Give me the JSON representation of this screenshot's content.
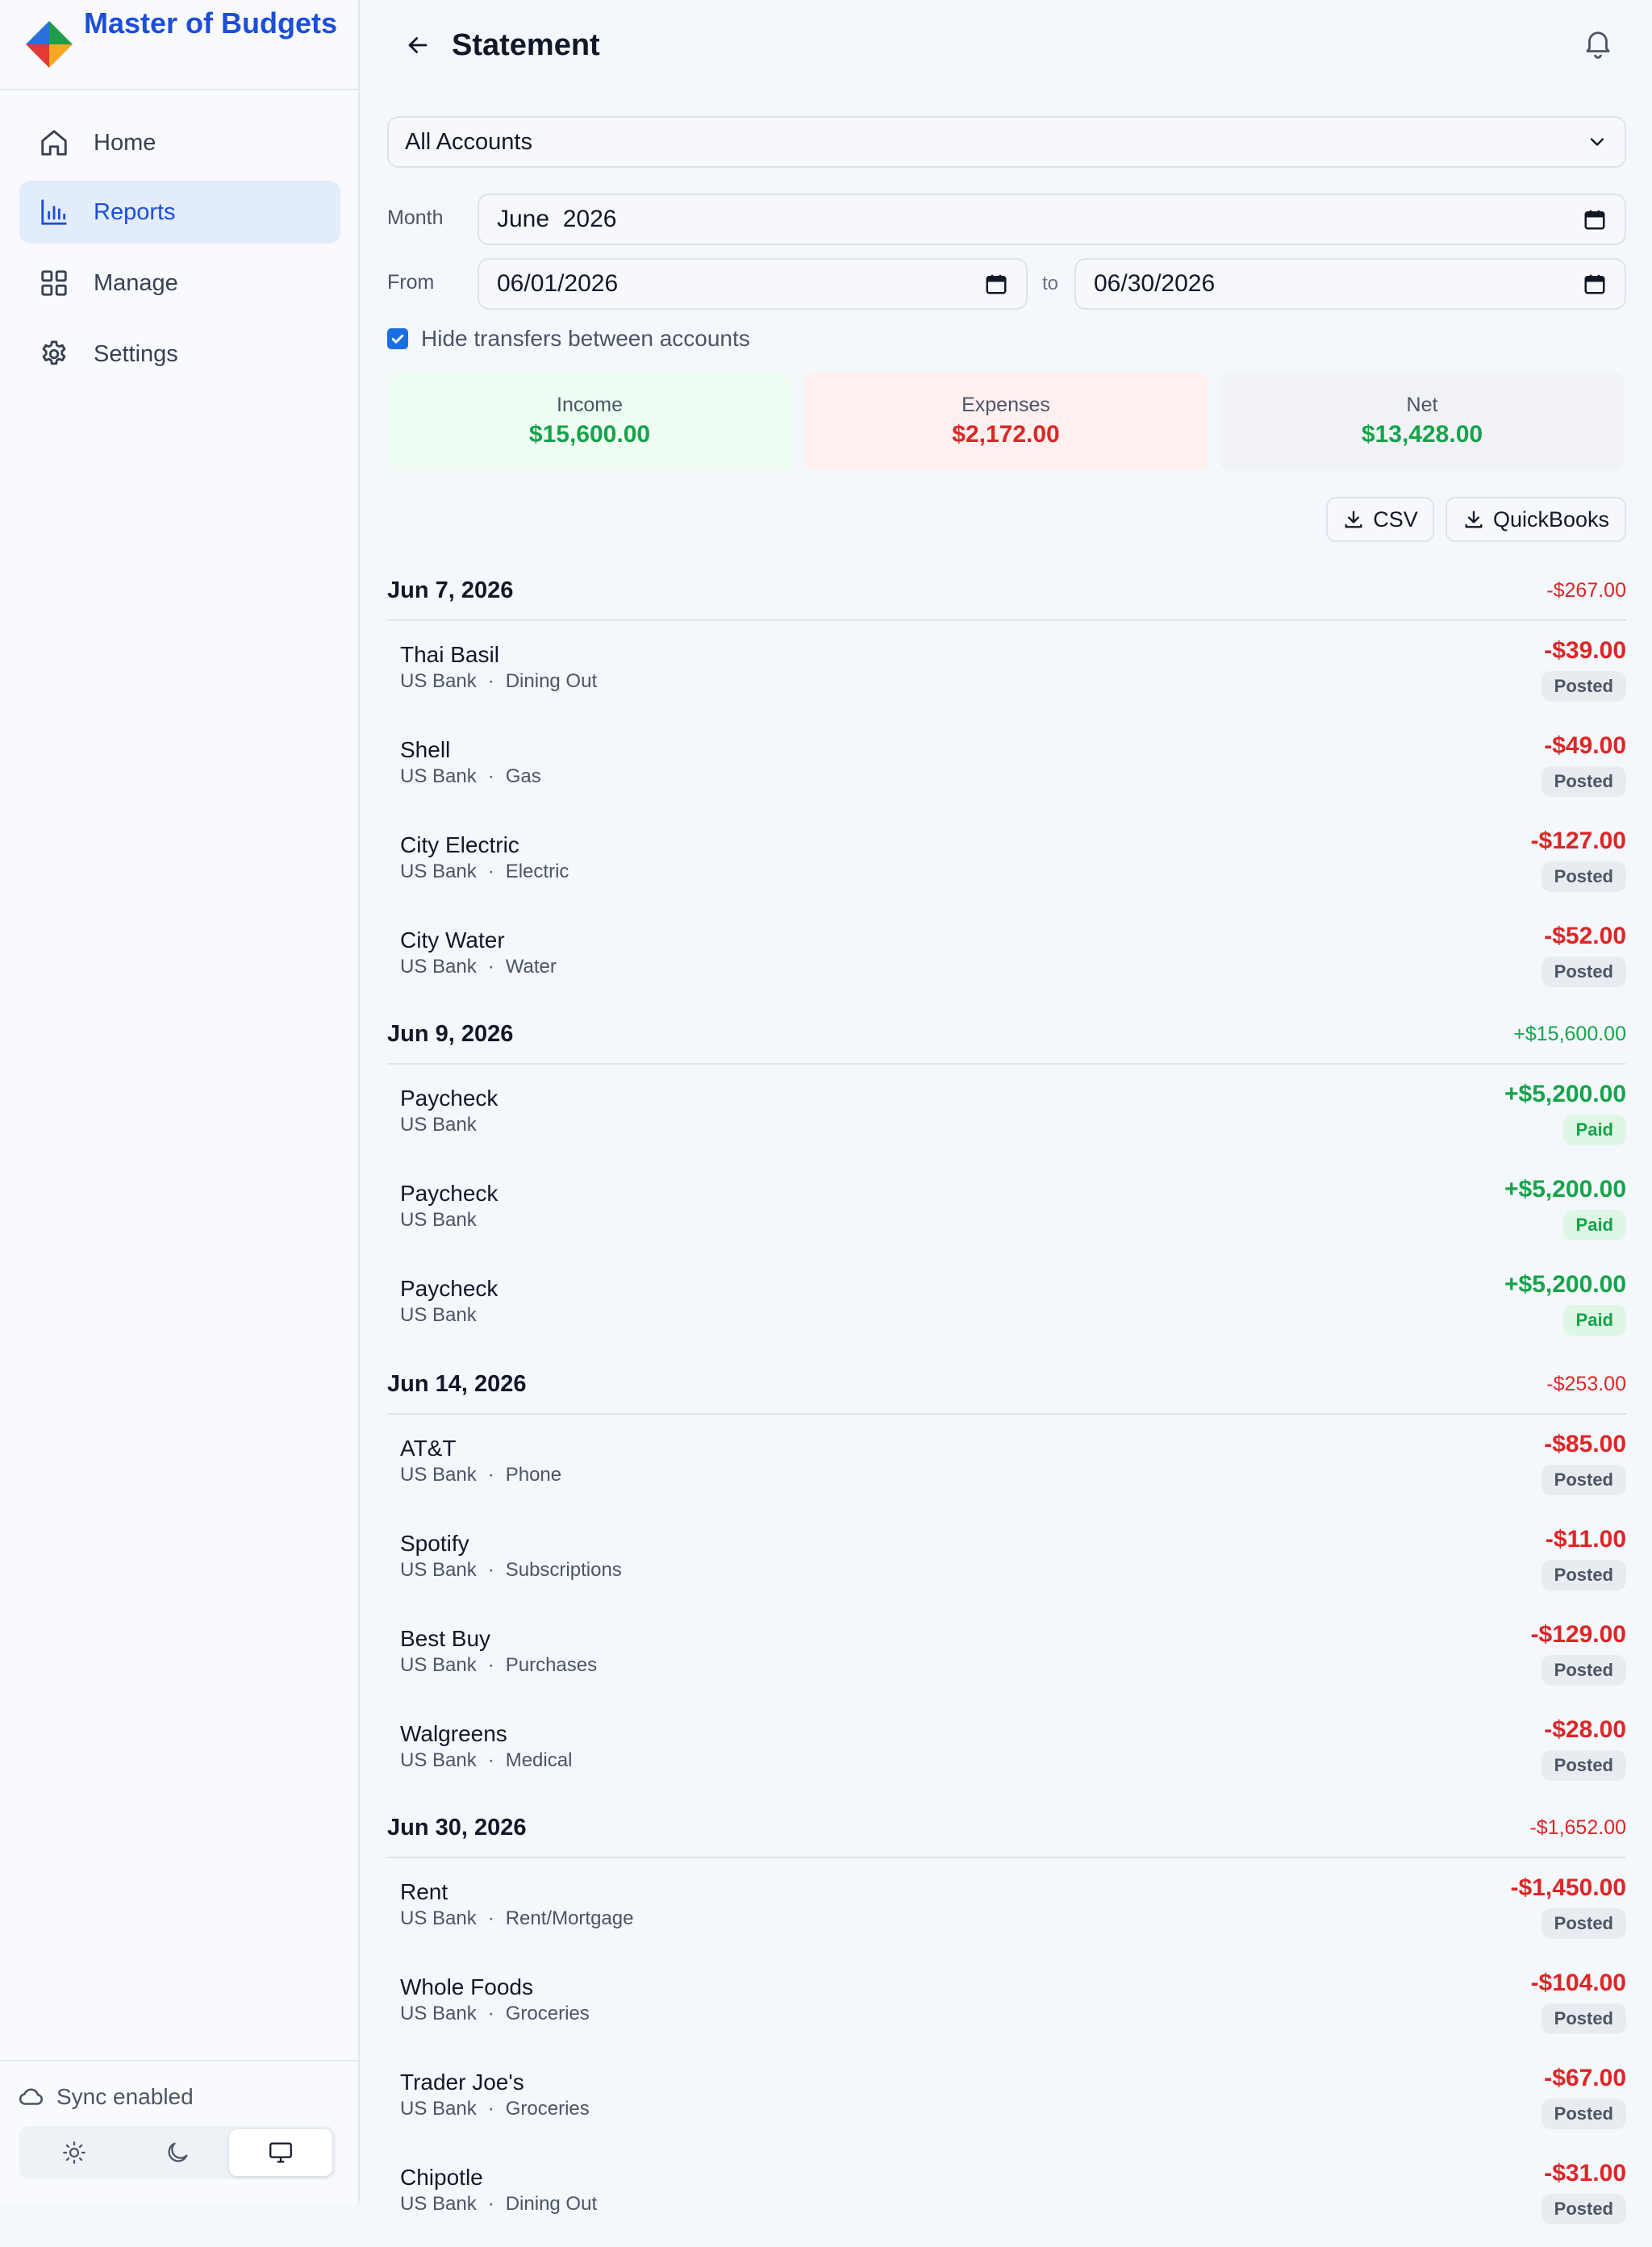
{
  "app": {
    "name": "Master of Budgets"
  },
  "sidebar": {
    "items": [
      {
        "label": "Home",
        "icon": "home-icon",
        "active": false
      },
      {
        "label": "Reports",
        "icon": "bar-chart-icon",
        "active": true
      },
      {
        "label": "Manage",
        "icon": "grid-icon",
        "active": false
      },
      {
        "label": "Settings",
        "icon": "gear-icon",
        "active": false
      }
    ],
    "sync_label": "Sync enabled",
    "theme_modes": [
      "light",
      "dark",
      "system"
    ],
    "theme_selected": "system"
  },
  "header": {
    "title": "Statement"
  },
  "filters": {
    "account": "All Accounts",
    "month_label": "Month",
    "month_value": "June  2026",
    "from_label": "From",
    "from_value": "06/01/2026",
    "to_label": "to",
    "to_value": "06/30/2026",
    "hide_transfers_label": "Hide transfers between accounts",
    "hide_transfers_checked": true
  },
  "summary": {
    "income_label": "Income",
    "income_value": "$15,600.00",
    "expenses_label": "Expenses",
    "expenses_value": "$2,172.00",
    "net_label": "Net",
    "net_value": "$13,428.00"
  },
  "exports": {
    "csv": "CSV",
    "quickbooks": "QuickBooks"
  },
  "groups": [
    {
      "date": "Jun 7, 2026",
      "total": "-$267.00",
      "sign": "neg",
      "txns": [
        {
          "payee": "Thai Basil",
          "account": "US Bank",
          "category": "Dining Out",
          "amount": "-$39.00",
          "status": "Posted"
        },
        {
          "payee": "Shell",
          "account": "US Bank",
          "category": "Gas",
          "amount": "-$49.00",
          "status": "Posted"
        },
        {
          "payee": "City Electric",
          "account": "US Bank",
          "category": "Electric",
          "amount": "-$127.00",
          "status": "Posted"
        },
        {
          "payee": "City Water",
          "account": "US Bank",
          "category": "Water",
          "amount": "-$52.00",
          "status": "Posted"
        }
      ]
    },
    {
      "date": "Jun 9, 2026",
      "total": "+$15,600.00",
      "sign": "pos",
      "txns": [
        {
          "payee": "Paycheck",
          "account": "US Bank",
          "category": "",
          "amount": "+$5,200.00",
          "status": "Paid"
        },
        {
          "payee": "Paycheck",
          "account": "US Bank",
          "category": "",
          "amount": "+$5,200.00",
          "status": "Paid"
        },
        {
          "payee": "Paycheck",
          "account": "US Bank",
          "category": "",
          "amount": "+$5,200.00",
          "status": "Paid"
        }
      ]
    },
    {
      "date": "Jun 14, 2026",
      "total": "-$253.00",
      "sign": "neg",
      "txns": [
        {
          "payee": "AT&T",
          "account": "US Bank",
          "category": "Phone",
          "amount": "-$85.00",
          "status": "Posted"
        },
        {
          "payee": "Spotify",
          "account": "US Bank",
          "category": "Subscriptions",
          "amount": "-$11.00",
          "status": "Posted"
        },
        {
          "payee": "Best Buy",
          "account": "US Bank",
          "category": "Purchases",
          "amount": "-$129.00",
          "status": "Posted"
        },
        {
          "payee": "Walgreens",
          "account": "US Bank",
          "category": "Medical",
          "amount": "-$28.00",
          "status": "Posted"
        }
      ]
    },
    {
      "date": "Jun 30, 2026",
      "total": "-$1,652.00",
      "sign": "neg",
      "txns": [
        {
          "payee": "Rent",
          "account": "US Bank",
          "category": "Rent/Mortgage",
          "amount": "-$1,450.00",
          "status": "Posted"
        },
        {
          "payee": "Whole Foods",
          "account": "US Bank",
          "category": "Groceries",
          "amount": "-$104.00",
          "status": "Posted"
        },
        {
          "payee": "Trader Joe's",
          "account": "US Bank",
          "category": "Groceries",
          "amount": "-$67.00",
          "status": "Posted"
        },
        {
          "payee": "Chipotle",
          "account": "US Bank",
          "category": "Dining Out",
          "amount": "-$31.00",
          "status": "Posted"
        }
      ]
    }
  ],
  "colors": {
    "brand": "#1d4ed8",
    "negative": "#dc2626",
    "positive": "#16a34a",
    "active_nav_bg": "#e3ecfb"
  }
}
